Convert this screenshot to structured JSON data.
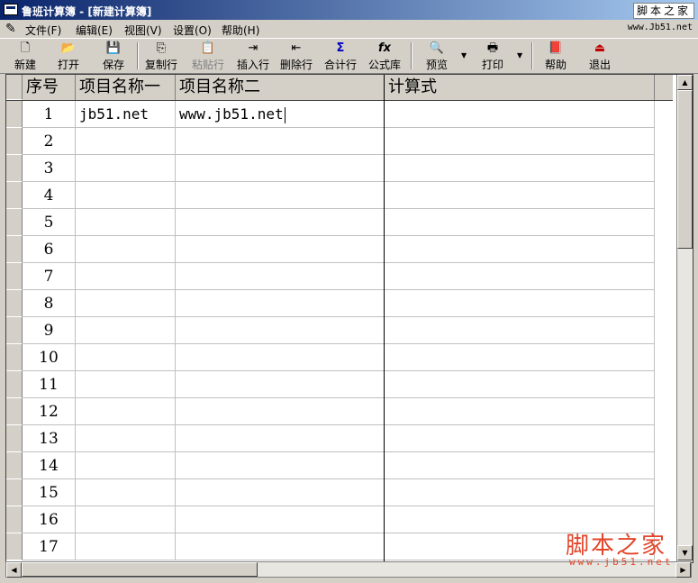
{
  "window": {
    "title": "鲁班计算簿 - [新建计算簿]",
    "logo_text": "脚本之家"
  },
  "menubar": {
    "items": [
      "文件(F)",
      "编辑(E)",
      "视图(V)",
      "设置(O)",
      "帮助(H)"
    ],
    "site_text": "www.Jb51.net"
  },
  "toolbar": {
    "new": "新建",
    "open": "打开",
    "save": "保存",
    "copy_row": "复制行",
    "paste_row": "粘贴行",
    "insert_row": "插入行",
    "delete_row": "删除行",
    "sum_row": "合计行",
    "formula_lib": "公式库",
    "preview": "预览",
    "print": "打印",
    "help": "帮助",
    "exit": "退出"
  },
  "grid": {
    "headers": [
      "序号",
      "项目名称一",
      "项目名称二",
      "计算式"
    ],
    "rows": [
      [
        "1",
        "jb51.net",
        "www.jb51.net",
        ""
      ],
      [
        "2",
        "",
        "",
        ""
      ],
      [
        "3",
        "",
        "",
        ""
      ],
      [
        "4",
        "",
        "",
        ""
      ],
      [
        "5",
        "",
        "",
        ""
      ],
      [
        "6",
        "",
        "",
        ""
      ],
      [
        "7",
        "",
        "",
        ""
      ],
      [
        "8",
        "",
        "",
        ""
      ],
      [
        "9",
        "",
        "",
        ""
      ],
      [
        "10",
        "",
        "",
        ""
      ],
      [
        "11",
        "",
        "",
        ""
      ],
      [
        "12",
        "",
        "",
        ""
      ],
      [
        "13",
        "",
        "",
        ""
      ],
      [
        "14",
        "",
        "",
        ""
      ],
      [
        "15",
        "",
        "",
        ""
      ],
      [
        "16",
        "",
        "",
        ""
      ],
      [
        "17",
        "",
        "",
        ""
      ]
    ]
  },
  "watermark": {
    "text": "脚本之家",
    "url": "www.jb51.net"
  },
  "colors": {
    "title_start": "#0a246a",
    "title_end": "#a6caf0",
    "face": "#d4d0c8",
    "watermark": "#e2462b"
  }
}
